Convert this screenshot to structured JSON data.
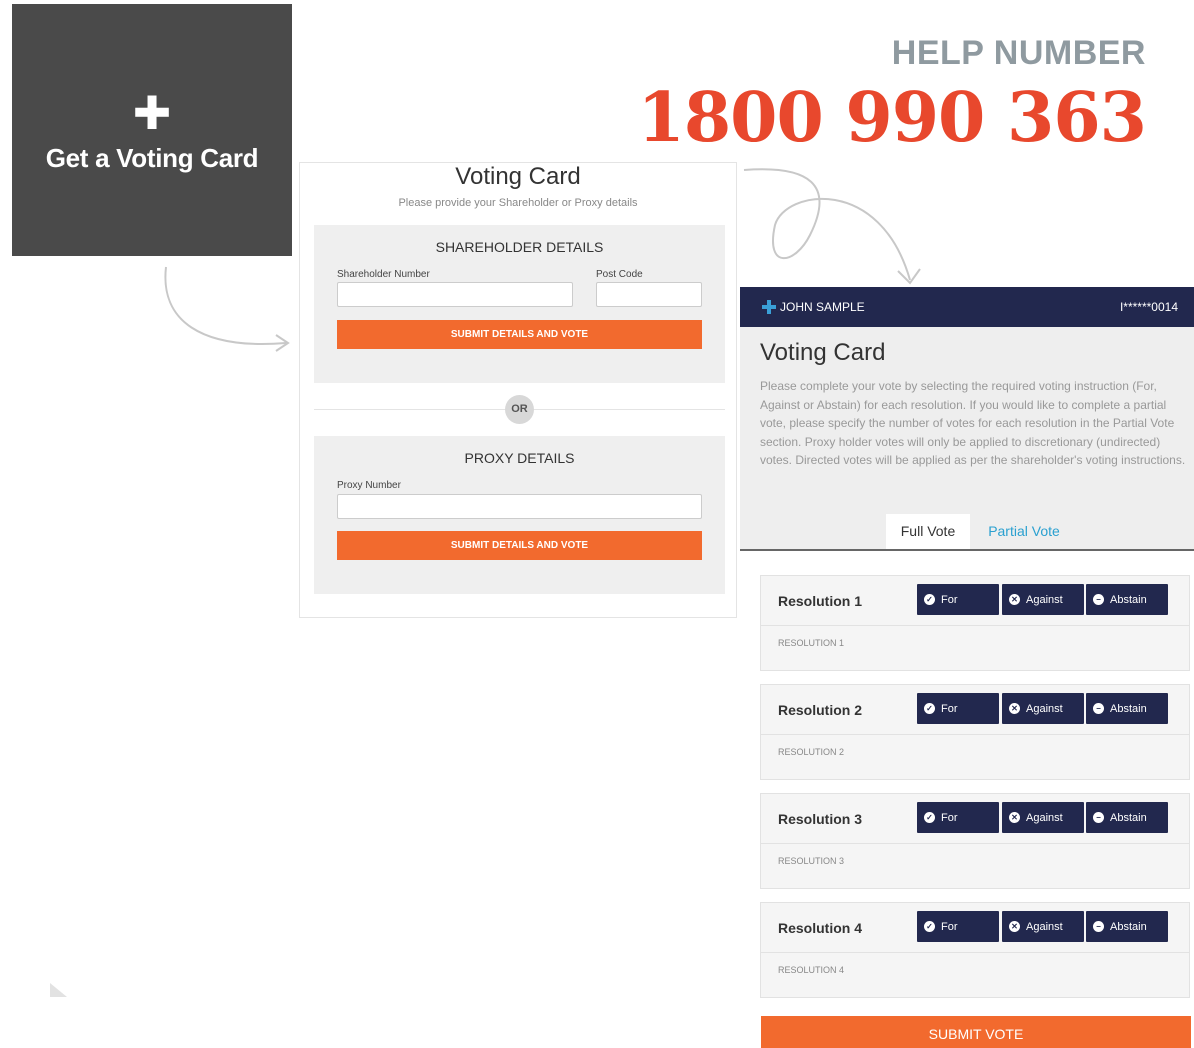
{
  "tile": {
    "icon": "plus-icon",
    "label": "Get a Voting Card"
  },
  "help": {
    "title": "HELP NUMBER",
    "number": "1800 990 363"
  },
  "form": {
    "title": "Voting Card",
    "subtitle": "Please provide your Shareholder or Proxy details",
    "shareholder": {
      "title": "SHAREHOLDER DETAILS",
      "number_label": "Shareholder Number",
      "number_value": "",
      "postcode_label": "Post Code",
      "postcode_value": "",
      "submit_label": "SUBMIT DETAILS AND VOTE"
    },
    "or_label": "OR",
    "proxy": {
      "title": "PROXY DETAILS",
      "number_label": "Proxy Number",
      "number_value": "",
      "submit_label": "SUBMIT DETAILS AND VOTE"
    }
  },
  "card": {
    "user_name": "JOHN SAMPLE",
    "account": "I******0014",
    "title": "Voting Card",
    "description": "Please complete your vote by selecting the required voting instruction (For, Against or Abstain) for each resolution. If you would like to complete a partial vote, please specify the number of votes for each resolution in the Partial Vote section. Proxy holder votes will only be applied to discretionary (undirected) votes. Directed votes will be applied as per the shareholder's voting instructions.",
    "tabs": [
      {
        "label": "Full Vote",
        "active": true
      },
      {
        "label": "Partial Vote",
        "active": false
      }
    ],
    "vote_labels": {
      "for": "For",
      "against": "Against",
      "abstain": "Abstain"
    },
    "resolutions": [
      {
        "title": "Resolution 1",
        "subtitle": "RESOLUTION 1"
      },
      {
        "title": "Resolution 2",
        "subtitle": "RESOLUTION 2"
      },
      {
        "title": "Resolution 3",
        "subtitle": "RESOLUTION 3"
      },
      {
        "title": "Resolution 4",
        "subtitle": "RESOLUTION 4"
      }
    ],
    "submit_label": "SUBMIT VOTE"
  },
  "colors": {
    "accent": "#f26a2e",
    "navy": "#22284e",
    "help_number": "#e8482d",
    "tab_link": "#2aa0d0"
  }
}
